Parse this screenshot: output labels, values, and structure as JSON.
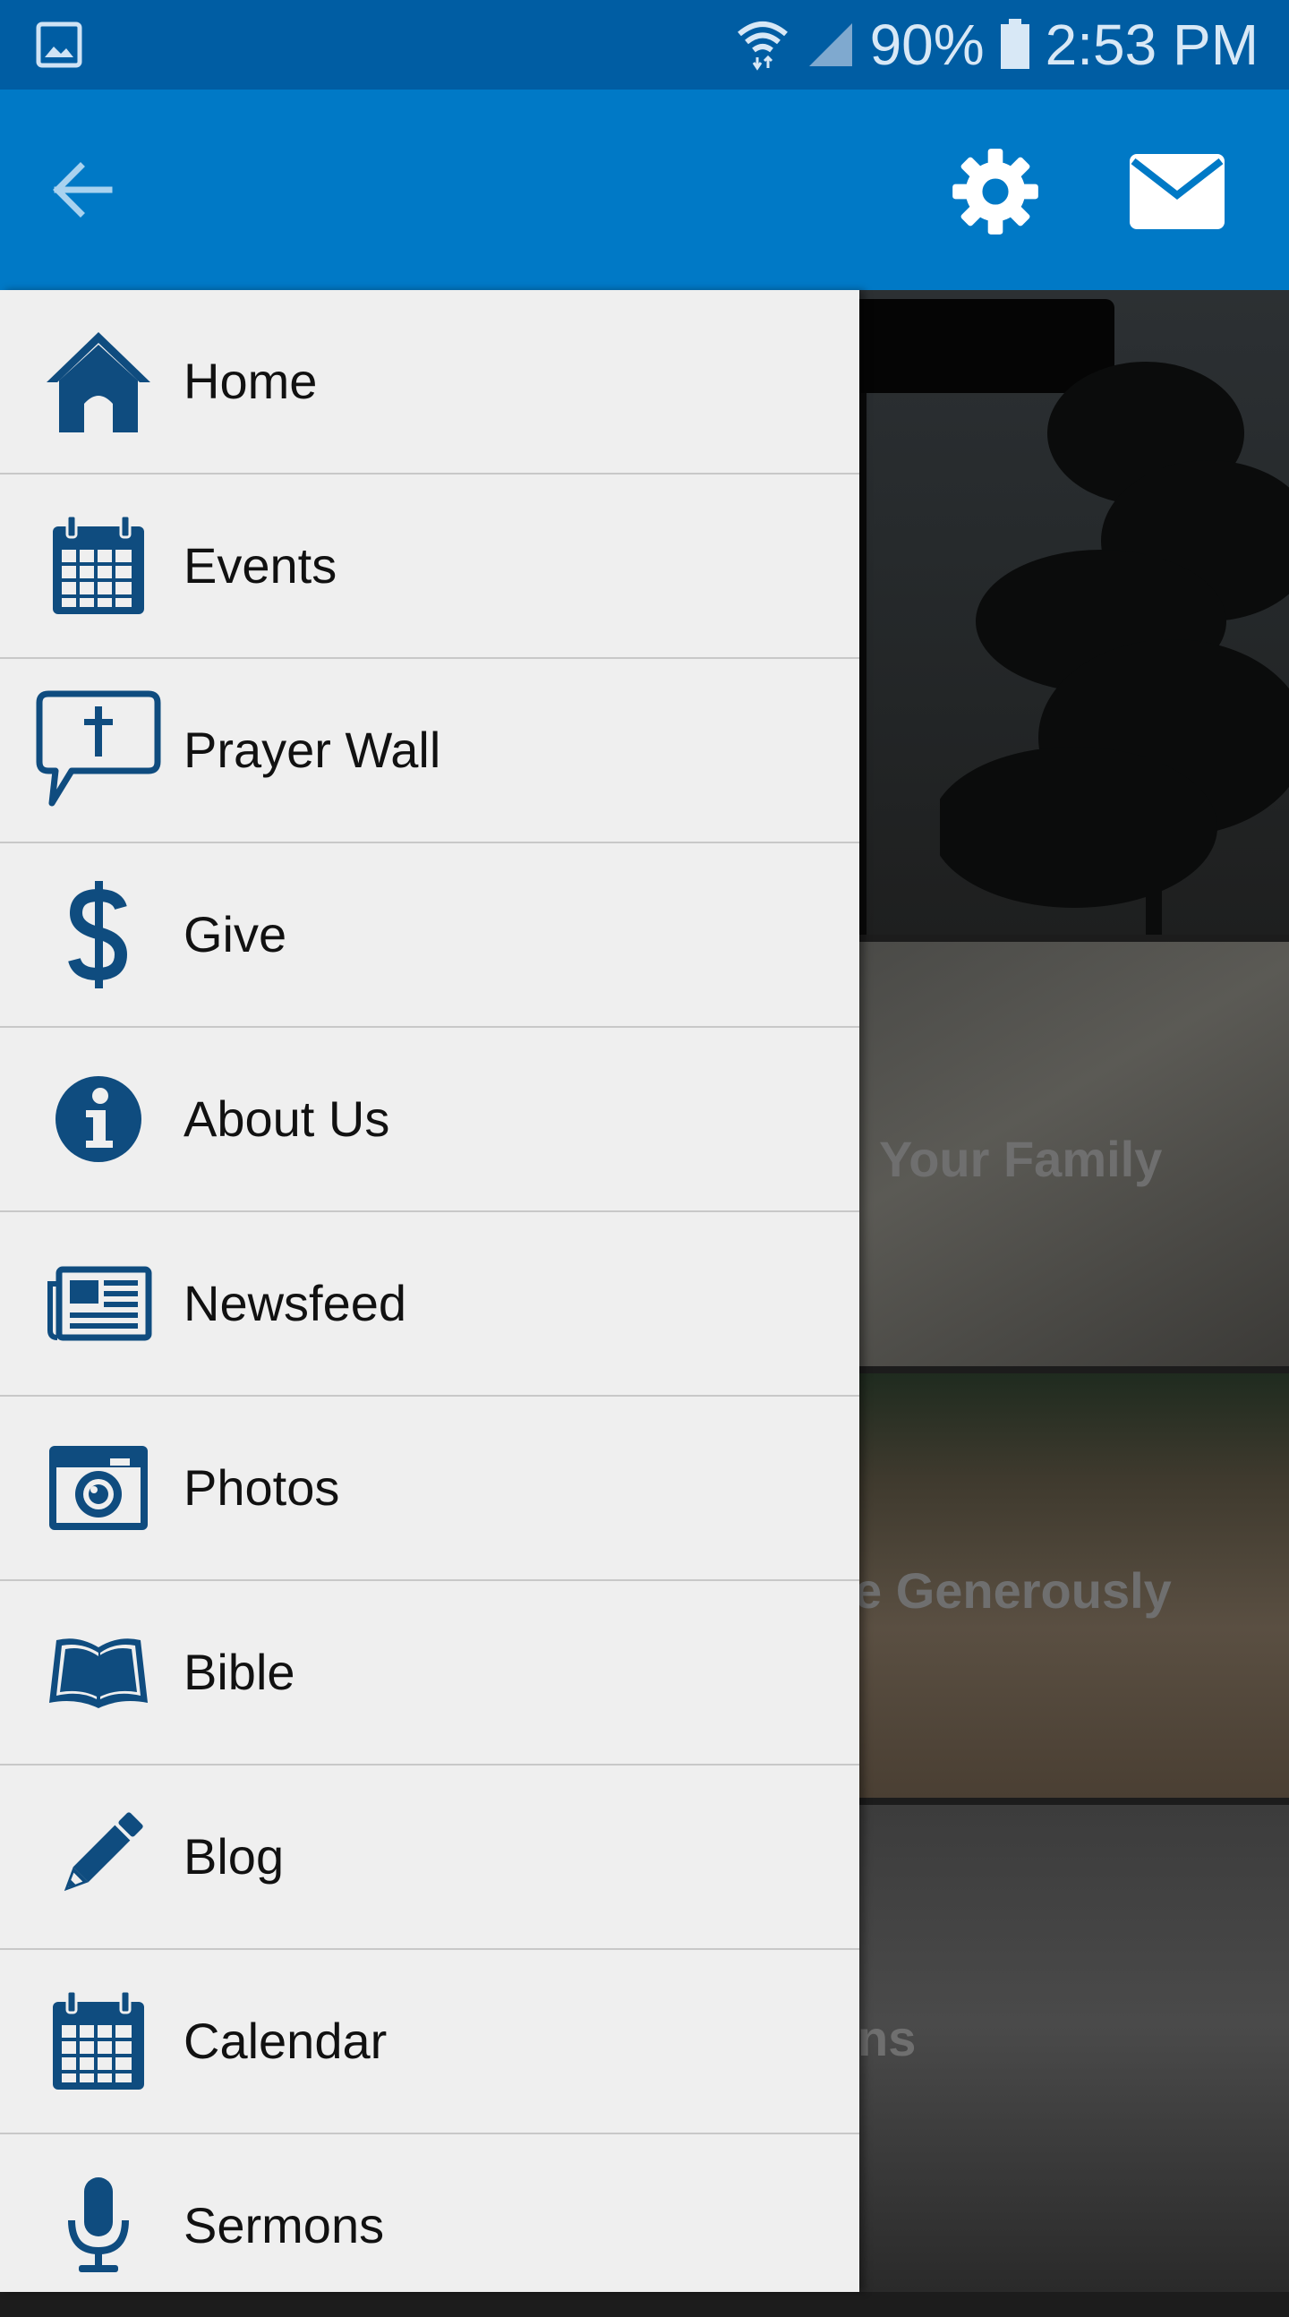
{
  "status_bar": {
    "battery": "90%",
    "time": "2:53 PM",
    "icons": [
      "gallery-icon",
      "wifi-icon",
      "signal-icon",
      "battery-icon"
    ]
  },
  "app_bar": {
    "icons": [
      "back-arrow-icon",
      "gear-icon",
      "mail-icon"
    ],
    "color": "#0079c6"
  },
  "drawer": {
    "items": [
      {
        "label": "Home",
        "icon": "home-icon"
      },
      {
        "label": "Events",
        "icon": "calendar-icon"
      },
      {
        "label": "Prayer Wall",
        "icon": "prayer-bubble-icon"
      },
      {
        "label": "Give",
        "icon": "dollar-icon"
      },
      {
        "label": "About Us",
        "icon": "info-icon"
      },
      {
        "label": "Newsfeed",
        "icon": "newspaper-icon"
      },
      {
        "label": "Photos",
        "icon": "camera-icon"
      },
      {
        "label": "Bible",
        "icon": "open-book-icon"
      },
      {
        "label": "Blog",
        "icon": "pencil-icon"
      },
      {
        "label": "Calendar",
        "icon": "calendar-icon"
      },
      {
        "label": "Sermons",
        "icon": "microphone-icon"
      }
    ],
    "icon_color": "#0f4c7f"
  },
  "background_tiles": [
    {
      "title": ""
    },
    {
      "title": "Your Family"
    },
    {
      "title": "e Generously"
    },
    {
      "title": "ns"
    }
  ]
}
